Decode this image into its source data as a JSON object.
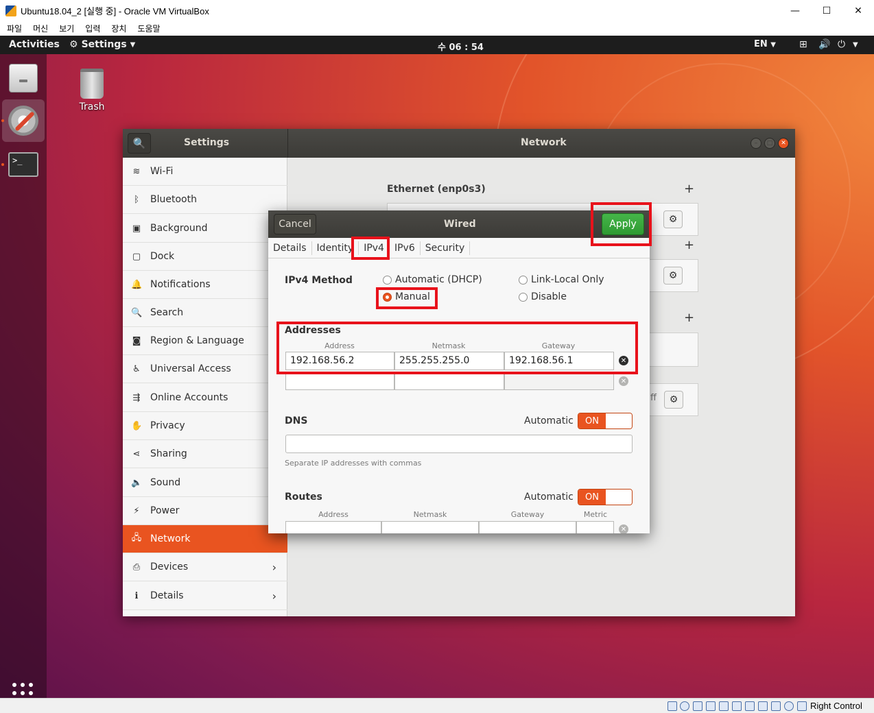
{
  "host": {
    "window_title": "Ubuntu18.04_2 [실행 중] - Oracle VM VirtualBox",
    "controls": {
      "minimize": "—",
      "maximize": "☐",
      "close": "✕"
    },
    "menu": [
      "파일",
      "머신",
      "보기",
      "입력",
      "장치",
      "도움말"
    ],
    "status_right": "Right Control"
  },
  "topbar": {
    "activities": "Activities",
    "app_menu": "Settings",
    "clock": "수 06 : 54",
    "language": "EN"
  },
  "desktop": {
    "trash_label": "Trash"
  },
  "settings": {
    "search_title": "Settings",
    "panel_title": "Network",
    "sidebar": [
      {
        "label": "Wi-Fi",
        "icon": "wifi-icon"
      },
      {
        "label": "Bluetooth",
        "icon": "bluetooth-icon"
      },
      {
        "label": "Background",
        "icon": "background-icon"
      },
      {
        "label": "Dock",
        "icon": "dock-icon"
      },
      {
        "label": "Notifications",
        "icon": "bell-icon"
      },
      {
        "label": "Search",
        "icon": "search-icon"
      },
      {
        "label": "Region & Language",
        "icon": "camera-icon"
      },
      {
        "label": "Universal Access",
        "icon": "accessibility-icon"
      },
      {
        "label": "Online Accounts",
        "icon": "online-accounts-icon"
      },
      {
        "label": "Privacy",
        "icon": "hand-icon"
      },
      {
        "label": "Sharing",
        "icon": "share-icon"
      },
      {
        "label": "Sound",
        "icon": "speaker-icon"
      },
      {
        "label": "Power",
        "icon": "power-icon"
      },
      {
        "label": "Network",
        "icon": "network-icon",
        "active": true
      },
      {
        "label": "Devices",
        "icon": "devices-icon",
        "chevron": true
      },
      {
        "label": "Details",
        "icon": "info-icon",
        "chevron": true
      }
    ],
    "ethernet_title": "Ethernet (enp0s3)",
    "partial_off_text": "ff"
  },
  "dialog": {
    "cancel": "Cancel",
    "title": "Wired",
    "apply": "Apply",
    "tabs": [
      "Details",
      "Identity",
      "IPv4",
      "IPv6",
      "Security"
    ],
    "active_tab": "IPv4",
    "ipv4_method_label": "IPv4 Method",
    "methods": {
      "automatic": "Automatic (DHCP)",
      "manual": "Manual",
      "link_local": "Link-Local Only",
      "disable": "Disable"
    },
    "selected_method": "Manual",
    "addresses_title": "Addresses",
    "address_headers": [
      "Address",
      "Netmask",
      "Gateway"
    ],
    "address_row": {
      "address": "192.168.56.2",
      "netmask": "255.255.255.0",
      "gateway": "192.168.56.1"
    },
    "dns_title": "DNS",
    "dns_automatic": "Automatic",
    "dns_switch": "ON",
    "dns_value": "",
    "dns_hint": "Separate IP addresses with commas",
    "routes_title": "Routes",
    "routes_automatic": "Automatic",
    "routes_switch": "ON",
    "route_headers": [
      "Address",
      "Netmask",
      "Gateway",
      "Metric"
    ]
  },
  "colors": {
    "ubuntu_orange": "#e95420",
    "apply_green": "#3aa83d",
    "annotation_red": "#e8121b"
  }
}
